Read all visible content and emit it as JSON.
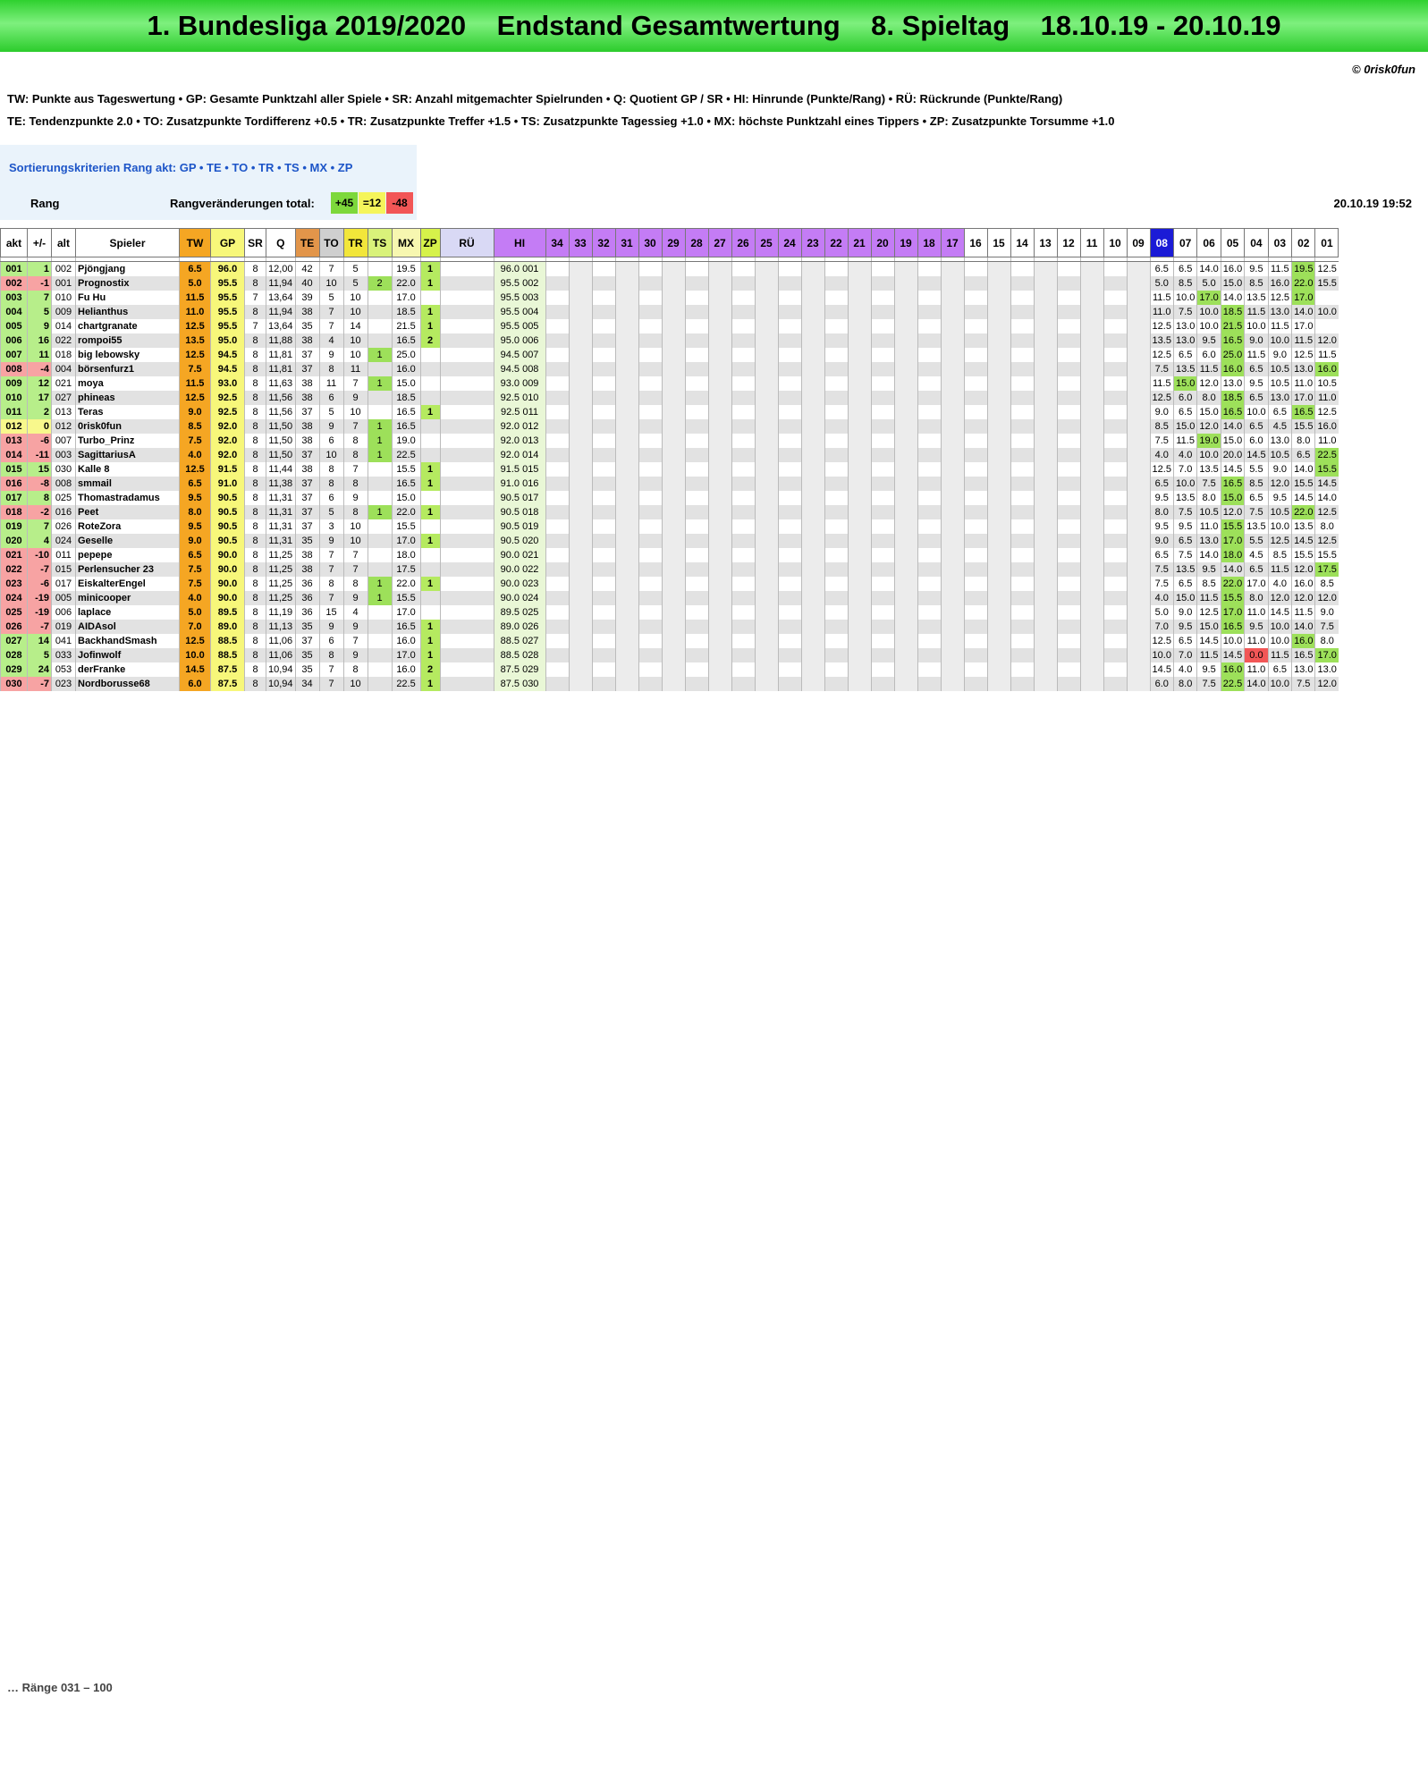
{
  "title": "1. Bundesliga 2019/2020    Endstand Gesamtwertung    8. Spieltag    18.10.19 - 20.10.19",
  "copyright": "© 0risk0fun",
  "legend_line1": "TW:  Punkte aus Tageswertung   •  GP: Gesamte Punktzahl aller Spiele   •  SR: Anzahl mitgemachter Spielrunden   •  Q: Quotient GP / SR   •  HI: Hinrunde (Punkte/Rang)   •  RÜ: Rückrunde (Punkte/Rang)",
  "legend_line2": "TE:  Tendenzpunkte 2.0   •  TO: Zusatzpunkte Tordifferenz +0.5   •  TR: Zusatzpunkte Treffer +1.5   •  TS: Zusatzpunkte Tagessieg +1.0   •  MX: höchste Punktzahl eines Tippers   •  ZP: Zusatzpunkte Torsumme +1.0",
  "sort_label": "Sortierungskriterien Rang akt:  GP  •  TE  •  TO  •  TR  •  TS  •  MX  •  ZP",
  "rang_label": "Rang",
  "rv_label": "Rangveränderungen total:",
  "rv_up": "+45",
  "rv_same": "=12",
  "rv_down": "-48",
  "timestamp": "20.10.19  19:52",
  "colors": {
    "title_green": "#33d633",
    "tw_orange": "#f5a623",
    "gp_yellow": "#f7f77a",
    "te_orange": "#e2954a",
    "hi_purple": "#c47cf5",
    "current_day": "#1b1bd6",
    "up_green": "#7dd83b",
    "down_red": "#f25656",
    "same_yellow": "#f5f55b"
  },
  "headers": [
    "akt",
    "+/-",
    "alt",
    "Spieler",
    "TW",
    "GP",
    "SR",
    "Q",
    "TE",
    "TO",
    "TR",
    "TS",
    "MX",
    "ZP",
    "RÜ",
    "HI",
    "34",
    "33",
    "32",
    "31",
    "30",
    "29",
    "28",
    "27",
    "26",
    "25",
    "24",
    "23",
    "22",
    "21",
    "20",
    "19",
    "18",
    "17",
    "16",
    "15",
    "14",
    "13",
    "12",
    "11",
    "10",
    "09",
    "08",
    "07",
    "06",
    "05",
    "04",
    "03",
    "02",
    "01"
  ],
  "rows": [
    {
      "akt": "001",
      "pm": "1",
      "alt": "002",
      "name": "Pjöngjang",
      "tw": "6.5",
      "gp": "96.0",
      "sr": "8",
      "q": "12,00",
      "te": "42",
      "to": "7",
      "tr": "5",
      "ts": "",
      "mx": "19.5",
      "zp": "1",
      "hi": "96.0  001",
      "days": [
        "6.5",
        "6.5",
        "14.0",
        "16.0",
        "9.5",
        "11.5",
        "19.5",
        "12.5"
      ]
    },
    {
      "akt": "002",
      "pm": "-1",
      "alt": "001",
      "name": "Prognostix",
      "tw": "5.0",
      "gp": "95.5",
      "sr": "8",
      "q": "11,94",
      "te": "40",
      "to": "10",
      "tr": "5",
      "ts": "2",
      "mx": "22.0",
      "zp": "1",
      "hi": "95.5  002",
      "days": [
        "5.0",
        "8.5",
        "5.0",
        "15.0",
        "8.5",
        "16.0",
        "22.0",
        "15.5"
      ]
    },
    {
      "akt": "003",
      "pm": "7",
      "alt": "010",
      "name": "Fu Hu",
      "tw": "11.5",
      "gp": "95.5",
      "sr": "7",
      "q": "13,64",
      "te": "39",
      "to": "5",
      "tr": "10",
      "ts": "",
      "mx": "17.0",
      "zp": "",
      "hi": "95.5  003",
      "days": [
        "11.5",
        "10.0",
        "17.0",
        "14.0",
        "13.5",
        "12.5",
        "17.0",
        ""
      ]
    },
    {
      "akt": "004",
      "pm": "5",
      "alt": "009",
      "name": "Helianthus",
      "tw": "11.0",
      "gp": "95.5",
      "sr": "8",
      "q": "11,94",
      "te": "38",
      "to": "7",
      "tr": "10",
      "ts": "",
      "mx": "18.5",
      "zp": "1",
      "hi": "95.5  004",
      "days": [
        "11.0",
        "7.5",
        "10.0",
        "18.5",
        "11.5",
        "13.0",
        "14.0",
        "10.0"
      ]
    },
    {
      "akt": "005",
      "pm": "9",
      "alt": "014",
      "name": "chartgranate",
      "tw": "12.5",
      "gp": "95.5",
      "sr": "7",
      "q": "13,64",
      "te": "35",
      "to": "7",
      "tr": "14",
      "ts": "",
      "mx": "21.5",
      "zp": "1",
      "hi": "95.5  005",
      "days": [
        "12.5",
        "13.0",
        "10.0",
        "21.5",
        "10.0",
        "11.5",
        "17.0",
        ""
      ]
    },
    {
      "akt": "006",
      "pm": "16",
      "alt": "022",
      "name": "rompoi55",
      "tw": "13.5",
      "gp": "95.0",
      "sr": "8",
      "q": "11,88",
      "te": "38",
      "to": "4",
      "tr": "10",
      "ts": "",
      "mx": "16.5",
      "zp": "2",
      "hi": "95.0  006",
      "days": [
        "13.5",
        "13.0",
        "9.5",
        "16.5",
        "9.0",
        "10.0",
        "11.5",
        "12.0"
      ]
    },
    {
      "akt": "007",
      "pm": "11",
      "alt": "018",
      "name": "big lebowsky",
      "tw": "12.5",
      "gp": "94.5",
      "sr": "8",
      "q": "11,81",
      "te": "37",
      "to": "9",
      "tr": "10",
      "ts": "1",
      "mx": "25.0",
      "zp": "",
      "hi": "94.5  007",
      "days": [
        "12.5",
        "6.5",
        "6.0",
        "25.0",
        "11.5",
        "9.0",
        "12.5",
        "11.5"
      ]
    },
    {
      "akt": "008",
      "pm": "-4",
      "alt": "004",
      "name": "börsenfurz1",
      "tw": "7.5",
      "gp": "94.5",
      "sr": "8",
      "q": "11,81",
      "te": "37",
      "to": "8",
      "tr": "11",
      "ts": "",
      "mx": "16.0",
      "zp": "",
      "hi": "94.5  008",
      "days": [
        "7.5",
        "13.5",
        "11.5",
        "16.0",
        "6.5",
        "10.5",
        "13.0",
        "16.0"
      ]
    },
    {
      "akt": "009",
      "pm": "12",
      "alt": "021",
      "name": "moya",
      "tw": "11.5",
      "gp": "93.0",
      "sr": "8",
      "q": "11,63",
      "te": "38",
      "to": "11",
      "tr": "7",
      "ts": "1",
      "mx": "15.0",
      "zp": "",
      "hi": "93.0  009",
      "days": [
        "11.5",
        "15.0",
        "12.0",
        "13.0",
        "9.5",
        "10.5",
        "11.0",
        "10.5"
      ]
    },
    {
      "akt": "010",
      "pm": "17",
      "alt": "027",
      "name": "phineas",
      "tw": "12.5",
      "gp": "92.5",
      "sr": "8",
      "q": "11,56",
      "te": "38",
      "to": "6",
      "tr": "9",
      "ts": "",
      "mx": "18.5",
      "zp": "",
      "hi": "92.5  010",
      "days": [
        "12.5",
        "6.0",
        "8.0",
        "18.5",
        "6.5",
        "13.0",
        "17.0",
        "11.0"
      ]
    },
    {
      "akt": "011",
      "pm": "2",
      "alt": "013",
      "name": "Teras",
      "tw": "9.0",
      "gp": "92.5",
      "sr": "8",
      "q": "11,56",
      "te": "37",
      "to": "5",
      "tr": "10",
      "ts": "",
      "mx": "16.5",
      "zp": "1",
      "hi": "92.5  011",
      "days": [
        "9.0",
        "6.5",
        "15.0",
        "16.5",
        "10.0",
        "6.5",
        "16.5",
        "12.5"
      ]
    },
    {
      "akt": "012",
      "pm": "0",
      "alt": "012",
      "name": "0risk0fun",
      "tw": "8.5",
      "gp": "92.0",
      "sr": "8",
      "q": "11,50",
      "te": "38",
      "to": "9",
      "tr": "7",
      "ts": "1",
      "mx": "16.5",
      "zp": "",
      "hi": "92.0  012",
      "days": [
        "8.5",
        "15.0",
        "12.0",
        "14.0",
        "6.5",
        "4.5",
        "15.5",
        "16.0"
      ]
    },
    {
      "akt": "013",
      "pm": "-6",
      "alt": "007",
      "name": "Turbo_Prinz",
      "tw": "7.5",
      "gp": "92.0",
      "sr": "8",
      "q": "11,50",
      "te": "38",
      "to": "6",
      "tr": "8",
      "ts": "1",
      "mx": "19.0",
      "zp": "",
      "hi": "92.0  013",
      "days": [
        "7.5",
        "11.5",
        "19.0",
        "15.0",
        "6.0",
        "13.0",
        "8.0",
        "11.0"
      ]
    },
    {
      "akt": "014",
      "pm": "-11",
      "alt": "003",
      "name": "SagittariusA",
      "tw": "4.0",
      "gp": "92.0",
      "sr": "8",
      "q": "11,50",
      "te": "37",
      "to": "10",
      "tr": "8",
      "ts": "1",
      "mx": "22.5",
      "zp": "",
      "hi": "92.0  014",
      "days": [
        "4.0",
        "4.0",
        "10.0",
        "20.0",
        "14.5",
        "10.5",
        "6.5",
        "22.5"
      ]
    },
    {
      "akt": "015",
      "pm": "15",
      "alt": "030",
      "name": "Kalle 8",
      "tw": "12.5",
      "gp": "91.5",
      "sr": "8",
      "q": "11,44",
      "te": "38",
      "to": "8",
      "tr": "7",
      "ts": "",
      "mx": "15.5",
      "zp": "1",
      "hi": "91.5  015",
      "days": [
        "12.5",
        "7.0",
        "13.5",
        "14.5",
        "5.5",
        "9.0",
        "14.0",
        "15.5"
      ]
    },
    {
      "akt": "016",
      "pm": "-8",
      "alt": "008",
      "name": "smmail",
      "tw": "6.5",
      "gp": "91.0",
      "sr": "8",
      "q": "11,38",
      "te": "37",
      "to": "8",
      "tr": "8",
      "ts": "",
      "mx": "16.5",
      "zp": "1",
      "hi": "91.0  016",
      "days": [
        "6.5",
        "10.0",
        "7.5",
        "16.5",
        "8.5",
        "12.0",
        "15.5",
        "14.5"
      ]
    },
    {
      "akt": "017",
      "pm": "8",
      "alt": "025",
      "name": "Thomastradamus",
      "tw": "9.5",
      "gp": "90.5",
      "sr": "8",
      "q": "11,31",
      "te": "37",
      "to": "6",
      "tr": "9",
      "ts": "",
      "mx": "15.0",
      "zp": "",
      "hi": "90.5  017",
      "days": [
        "9.5",
        "13.5",
        "8.0",
        "15.0",
        "6.5",
        "9.5",
        "14.5",
        "14.0"
      ]
    },
    {
      "akt": "018",
      "pm": "-2",
      "alt": "016",
      "name": "Peet",
      "tw": "8.0",
      "gp": "90.5",
      "sr": "8",
      "q": "11,31",
      "te": "37",
      "to": "5",
      "tr": "8",
      "ts": "1",
      "mx": "22.0",
      "zp": "1",
      "hi": "90.5  018",
      "days": [
        "8.0",
        "7.5",
        "10.5",
        "12.0",
        "7.5",
        "10.5",
        "22.0",
        "12.5"
      ]
    },
    {
      "akt": "019",
      "pm": "7",
      "alt": "026",
      "name": "RoteZora",
      "tw": "9.5",
      "gp": "90.5",
      "sr": "8",
      "q": "11,31",
      "te": "37",
      "to": "3",
      "tr": "10",
      "ts": "",
      "mx": "15.5",
      "zp": "",
      "hi": "90.5  019",
      "days": [
        "9.5",
        "9.5",
        "11.0",
        "15.5",
        "13.5",
        "10.0",
        "13.5",
        "8.0"
      ]
    },
    {
      "akt": "020",
      "pm": "4",
      "alt": "024",
      "name": "Geselle",
      "tw": "9.0",
      "gp": "90.5",
      "sr": "8",
      "q": "11,31",
      "te": "35",
      "to": "9",
      "tr": "10",
      "ts": "",
      "mx": "17.0",
      "zp": "1",
      "hi": "90.5  020",
      "days": [
        "9.0",
        "6.5",
        "13.0",
        "17.0",
        "5.5",
        "12.5",
        "14.5",
        "12.5"
      ]
    },
    {
      "akt": "021",
      "pm": "-10",
      "alt": "011",
      "name": "pepepe",
      "tw": "6.5",
      "gp": "90.0",
      "sr": "8",
      "q": "11,25",
      "te": "38",
      "to": "7",
      "tr": "7",
      "ts": "",
      "mx": "18.0",
      "zp": "",
      "hi": "90.0  021",
      "days": [
        "6.5",
        "7.5",
        "14.0",
        "18.0",
        "4.5",
        "8.5",
        "15.5",
        "15.5"
      ]
    },
    {
      "akt": "022",
      "pm": "-7",
      "alt": "015",
      "name": "Perlensucher 23",
      "tw": "7.5",
      "gp": "90.0",
      "sr": "8",
      "q": "11,25",
      "te": "38",
      "to": "7",
      "tr": "7",
      "ts": "",
      "mx": "17.5",
      "zp": "",
      "hi": "90.0  022",
      "days": [
        "7.5",
        "13.5",
        "9.5",
        "14.0",
        "6.5",
        "11.5",
        "12.0",
        "17.5"
      ]
    },
    {
      "akt": "023",
      "pm": "-6",
      "alt": "017",
      "name": "EiskalterEngel",
      "tw": "7.5",
      "gp": "90.0",
      "sr": "8",
      "q": "11,25",
      "te": "36",
      "to": "8",
      "tr": "8",
      "ts": "1",
      "mx": "22.0",
      "zp": "1",
      "hi": "90.0  023",
      "days": [
        "7.5",
        "6.5",
        "8.5",
        "22.0",
        "17.0",
        "4.0",
        "16.0",
        "8.5"
      ]
    },
    {
      "akt": "024",
      "pm": "-19",
      "alt": "005",
      "name": "minicooper",
      "tw": "4.0",
      "gp": "90.0",
      "sr": "8",
      "q": "11,25",
      "te": "36",
      "to": "7",
      "tr": "9",
      "ts": "1",
      "mx": "15.5",
      "zp": "",
      "hi": "90.0  024",
      "days": [
        "4.0",
        "15.0",
        "11.5",
        "15.5",
        "8.0",
        "12.0",
        "12.0",
        "12.0"
      ]
    },
    {
      "akt": "025",
      "pm": "-19",
      "alt": "006",
      "name": "laplace",
      "tw": "5.0",
      "gp": "89.5",
      "sr": "8",
      "q": "11,19",
      "te": "36",
      "to": "15",
      "tr": "4",
      "ts": "",
      "mx": "17.0",
      "zp": "",
      "hi": "89.5  025",
      "days": [
        "5.0",
        "9.0",
        "12.5",
        "17.0",
        "11.0",
        "14.5",
        "11.5",
        "9.0"
      ]
    },
    {
      "akt": "026",
      "pm": "-7",
      "alt": "019",
      "name": "AIDAsol",
      "tw": "7.0",
      "gp": "89.0",
      "sr": "8",
      "q": "11,13",
      "te": "35",
      "to": "9",
      "tr": "9",
      "ts": "",
      "mx": "16.5",
      "zp": "1",
      "hi": "89.0  026",
      "days": [
        "7.0",
        "9.5",
        "15.0",
        "16.5",
        "9.5",
        "10.0",
        "14.0",
        "7.5"
      ]
    },
    {
      "akt": "027",
      "pm": "14",
      "alt": "041",
      "name": "BackhandSmash",
      "tw": "12.5",
      "gp": "88.5",
      "sr": "8",
      "q": "11,06",
      "te": "37",
      "to": "6",
      "tr": "7",
      "ts": "",
      "mx": "16.0",
      "zp": "1",
      "hi": "88.5  027",
      "days": [
        "12.5",
        "6.5",
        "14.5",
        "10.0",
        "11.0",
        "10.0",
        "16.0",
        "8.0"
      ]
    },
    {
      "akt": "028",
      "pm": "5",
      "alt": "033",
      "name": "Jofinwolf",
      "tw": "10.0",
      "gp": "88.5",
      "sr": "8",
      "q": "11,06",
      "te": "35",
      "to": "8",
      "tr": "9",
      "ts": "",
      "mx": "17.0",
      "zp": "1",
      "hi": "88.5  028",
      "days": [
        "10.0",
        "7.0",
        "11.5",
        "14.5",
        "0.0",
        "11.5",
        "16.5",
        "17.0"
      ]
    },
    {
      "akt": "029",
      "pm": "24",
      "alt": "053",
      "name": "derFranke",
      "tw": "14.5",
      "gp": "87.5",
      "sr": "8",
      "q": "10,94",
      "te": "35",
      "to": "7",
      "tr": "8",
      "ts": "",
      "mx": "16.0",
      "zp": "2",
      "hi": "87.5  029",
      "days": [
        "14.5",
        "4.0",
        "9.5",
        "16.0",
        "11.0",
        "6.5",
        "13.0",
        "13.0"
      ]
    },
    {
      "akt": "030",
      "pm": "-7",
      "alt": "023",
      "name": "Nordborusse68",
      "tw": "6.0",
      "gp": "87.5",
      "sr": "8",
      "q": "10,94",
      "te": "34",
      "to": "7",
      "tr": "10",
      "ts": "",
      "mx": "22.5",
      "zp": "1",
      "hi": "87.5  030",
      "days": [
        "6.0",
        "8.0",
        "7.5",
        "22.5",
        "14.0",
        "10.0",
        "7.5",
        "12.0"
      ]
    }
  ],
  "more_rows_note": "… Ränge 031 – 100"
}
